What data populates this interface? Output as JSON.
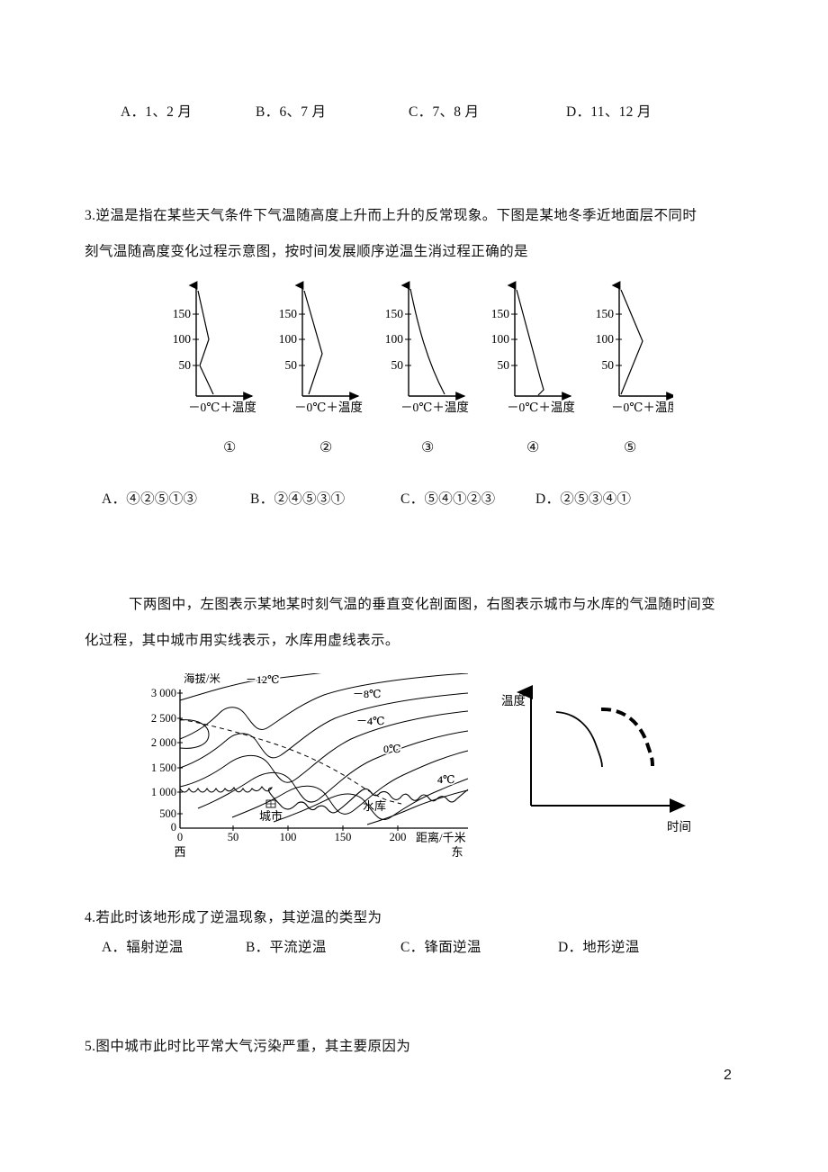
{
  "page": {
    "number": "2"
  },
  "question2": {
    "options": [
      "A．1、2 月",
      "B．6、7 月",
      "C．7、8 月",
      "D．11、12 月"
    ]
  },
  "question3": {
    "stem_line1": "3.逆温是指在某些天气条件下气温随高度上升而上升的反常现象。下图是某地冬季近地面层不同时",
    "stem_line2": "刻气温随高度变化过程示意图，按时间发展顺序逆温生消过程正确的是",
    "figure_captions": [
      "①",
      "②",
      "③",
      "④",
      "⑤"
    ],
    "options": [
      "A．④②⑤①③",
      "B．②④⑤③①",
      "C．⑤④①②③",
      "D．②⑤③④①"
    ],
    "diagram": {
      "y_ticks": [
        "150",
        "100",
        "50"
      ],
      "x_axis_label": "－0℃＋温度"
    }
  },
  "intro": {
    "line1": "下两图中，左图表示某地某时刻气温的垂直变化剖面图，右图表示城市与水库的气温随时间变",
    "line2": "化过程，其中城市用实线表示，水库用虚线表示。"
  },
  "contour_chart": {
    "y_axis_label": "海拔/米",
    "x_axis_label": "距离/千米",
    "y_ticks": [
      "3 000",
      "2 500",
      "2 000",
      "1 500",
      "1 000",
      "500",
      "0"
    ],
    "x_ticks": [
      "0",
      "50",
      "100",
      "150",
      "200"
    ],
    "direction_west": "西",
    "direction_east": "东",
    "isotherm_labels": [
      "－12℃",
      "－8℃",
      "－4℃",
      "0℃",
      "4℃"
    ],
    "feature_labels": [
      "城市",
      "水库"
    ]
  },
  "time_temp_chart": {
    "y_axis_label": "温度",
    "x_axis_label": "时间",
    "series": [
      {
        "name": "城市",
        "style": "solid"
      },
      {
        "name": "水库",
        "style": "dashed"
      }
    ]
  },
  "question4": {
    "stem": "4.若此时该地形成了逆温现象，其逆温的类型为",
    "options": [
      "A．辐射逆温",
      "B．平流逆温",
      "C．锋面逆温",
      "D．地形逆温"
    ]
  },
  "question5": {
    "stem": "5.图中城市此时比平常大气污染严重，其主要原因为"
  }
}
